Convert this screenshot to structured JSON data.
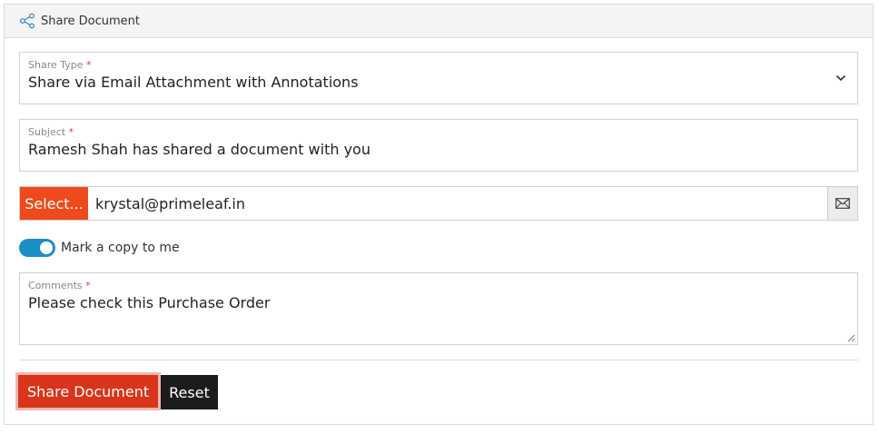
{
  "header": {
    "title": "Share Document",
    "icon": "share-icon"
  },
  "share_type": {
    "label": "Share Type",
    "required_mark": "*",
    "value": "Share via Email Attachment with Annotations"
  },
  "subject": {
    "label": "Subject",
    "required_mark": "*",
    "value": "Ramesh Shah has shared a document with you"
  },
  "recipients": {
    "select_label": "Select...",
    "value": "krystal@primeleaf.in",
    "icon": "envelope-icon"
  },
  "copy_toggle": {
    "label": "Mark a copy to me",
    "on": true
  },
  "comments": {
    "label": "Comments",
    "required_mark": "*",
    "value": "Please check this Purchase Order"
  },
  "actions": {
    "share_label": "Share Document",
    "reset_label": "Reset"
  },
  "colors": {
    "select_button": "#ee4a1c",
    "share_button": "#d9351a",
    "reset_button": "#1c1c1c",
    "toggle_on": "#1b8fc4",
    "required": "#e53935"
  }
}
